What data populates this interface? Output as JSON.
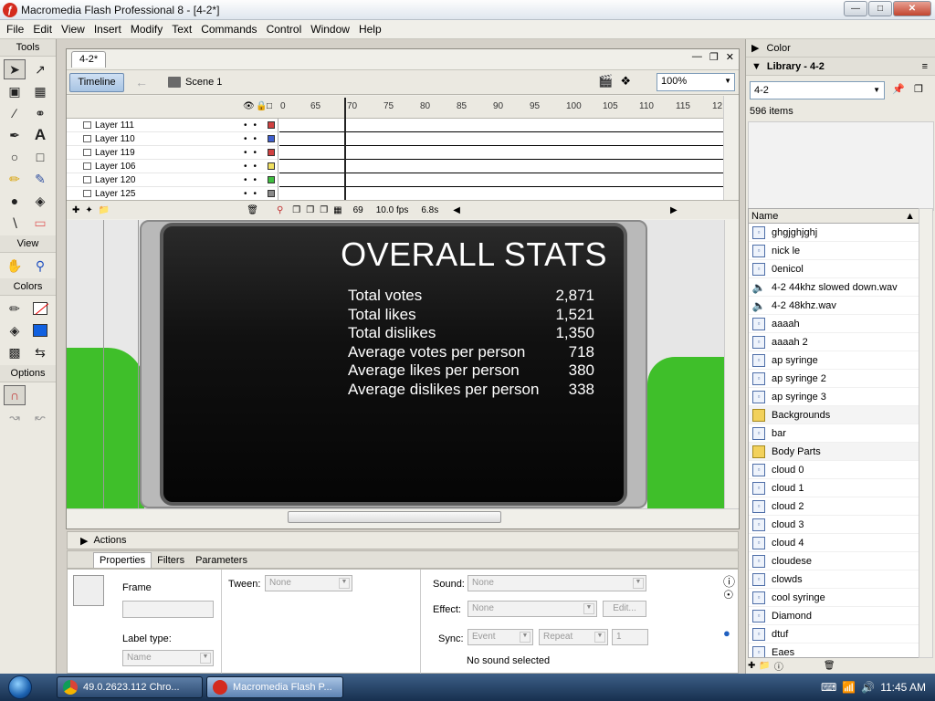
{
  "window": {
    "title": "Macromedia Flash Professional 8 - [4-2*]",
    "controls": [
      "minimize",
      "maximize",
      "close"
    ]
  },
  "menu": [
    "File",
    "Edit",
    "View",
    "Insert",
    "Modify",
    "Text",
    "Commands",
    "Control",
    "Window",
    "Help"
  ],
  "tools": {
    "title": "Tools",
    "view_title": "View",
    "colors_title": "Colors",
    "options_title": "Options"
  },
  "document": {
    "tab": "4-2*",
    "timeline_button": "Timeline",
    "scene": "Scene 1",
    "zoom": "100%"
  },
  "timeline": {
    "ruler": [
      "0",
      "65",
      "70",
      "75",
      "80",
      "85",
      "90",
      "95",
      "100",
      "105",
      "110",
      "115",
      "12"
    ],
    "layers": [
      {
        "name": "Layer 111",
        "color": "#d04040"
      },
      {
        "name": "Layer 110",
        "color": "#4060d0"
      },
      {
        "name": "Layer 119",
        "color": "#d04040"
      },
      {
        "name": "Layer 106",
        "color": "#f0e060"
      },
      {
        "name": "Layer 120",
        "color": "#40c040"
      },
      {
        "name": "Layer 125",
        "color": "#8a8a8a"
      }
    ],
    "current_frame": "69",
    "fps": "10.0 fps",
    "time": "6.8s"
  },
  "stage": {
    "title": "OVERALL STATS",
    "stats": [
      {
        "label": "Total votes",
        "value": "2,871"
      },
      {
        "label": "Total likes",
        "value": "1,521"
      },
      {
        "label": "Total dislikes",
        "value": "1,350"
      },
      {
        "label": "Average votes per person",
        "value": "718"
      },
      {
        "label": "Average likes per person",
        "value": "380"
      },
      {
        "label": "Average dislikes per person",
        "value": "338"
      }
    ]
  },
  "actions": {
    "label": "Actions"
  },
  "properties": {
    "tabs": [
      "Properties",
      "Filters",
      "Parameters"
    ],
    "frame_label": "Frame",
    "tween_label": "Tween:",
    "tween_value": "None",
    "label_type_label": "Label type:",
    "label_type_value": "Name",
    "sound_label": "Sound:",
    "sound_value": "None",
    "effect_label": "Effect:",
    "effect_value": "None",
    "edit_button": "Edit...",
    "sync_label": "Sync:",
    "sync_value": "Event",
    "repeat_value": "Repeat",
    "repeat_count": "1",
    "sound_status": "No sound selected"
  },
  "right_panel": {
    "color_title": "Color",
    "library_title": "Library - 4-2",
    "library_select": "4-2",
    "item_count": "596 items",
    "column": "Name",
    "items": [
      {
        "name": "ghgjghjghj",
        "type": "symbol"
      },
      {
        "name": "nick le",
        "type": "symbol"
      },
      {
        "name": "0enicol",
        "type": "symbol"
      },
      {
        "name": "4-2 44khz slowed down.wav",
        "type": "sound"
      },
      {
        "name": "4-2 48khz.wav",
        "type": "sound"
      },
      {
        "name": "aaaah",
        "type": "symbol"
      },
      {
        "name": "aaaah 2",
        "type": "symbol"
      },
      {
        "name": "ap syringe",
        "type": "symbol"
      },
      {
        "name": "ap syringe 2",
        "type": "symbol"
      },
      {
        "name": "ap syringe 3",
        "type": "symbol"
      },
      {
        "name": "Backgrounds",
        "type": "folder"
      },
      {
        "name": "bar",
        "type": "symbol"
      },
      {
        "name": "Body Parts",
        "type": "folder"
      },
      {
        "name": "cloud 0",
        "type": "symbol"
      },
      {
        "name": "cloud 1",
        "type": "symbol"
      },
      {
        "name": "cloud 2",
        "type": "symbol"
      },
      {
        "name": "cloud 3",
        "type": "symbol"
      },
      {
        "name": "cloud 4",
        "type": "symbol"
      },
      {
        "name": "cloudese",
        "type": "symbol"
      },
      {
        "name": "clowds",
        "type": "symbol"
      },
      {
        "name": "cool syringe",
        "type": "symbol"
      },
      {
        "name": "Diamond",
        "type": "symbol"
      },
      {
        "name": "dtuf",
        "type": "symbol"
      },
      {
        "name": "Eaes",
        "type": "symbol"
      }
    ]
  },
  "taskbar": {
    "tasks": [
      {
        "label": "49.0.2623.112 Chro...",
        "active": false
      },
      {
        "label": "Macromedia Flash P...",
        "active": true
      }
    ],
    "clock": "11:45 AM"
  }
}
